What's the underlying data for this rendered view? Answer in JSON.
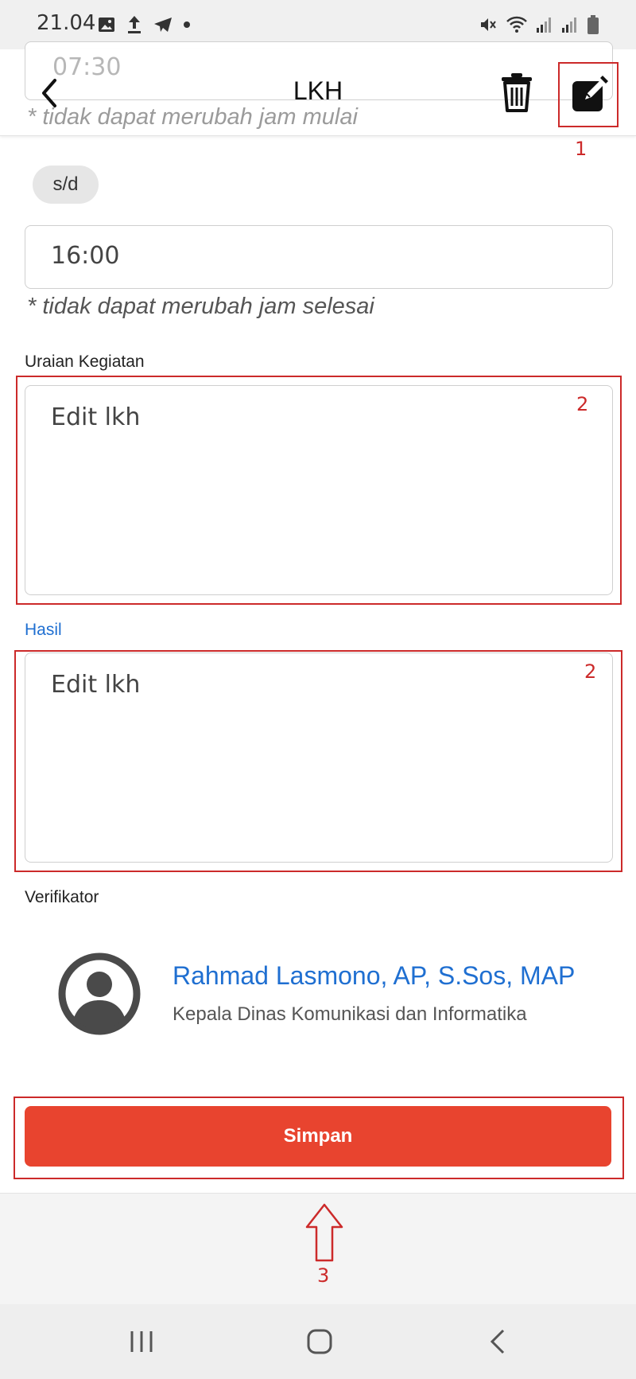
{
  "status_bar": {
    "time": "21.04",
    "icons_left": [
      "image-icon",
      "upload-icon",
      "telegram-icon",
      "dot-icon"
    ],
    "icons_right": [
      "mute-icon",
      "wifi-icon",
      "signal-icon",
      "signal-icon",
      "battery-icon"
    ]
  },
  "header": {
    "title": "LKH",
    "back_icon": "chevron-left-icon",
    "delete_icon": "trash-icon",
    "edit_icon": "edit-icon"
  },
  "form": {
    "start_time_value": "07:30",
    "start_hint": "* tidak dapat merubah jam mulai",
    "range_chip": "s/d",
    "end_time_value": "16:00",
    "end_hint": "* tidak dapat merubah jam selesai",
    "uraian_label": "Uraian Kegiatan",
    "uraian_value": "Edit lkh",
    "hasil_label": "Hasil",
    "hasil_value": "Edit lkh",
    "verifikator_label": "Verifikator"
  },
  "verifikator": {
    "name": "Rahmad Lasmono, AP, S.Sos, MAP",
    "role": "Kepala Dinas Komunikasi dan Informatika"
  },
  "actions": {
    "save_label": "Simpan"
  },
  "annotations": {
    "edit_marker": "1",
    "uraian_marker": "2",
    "hasil_marker": "2",
    "save_marker": "3"
  },
  "colors": {
    "accent_blue": "#1f6fd1",
    "save_red": "#e8442f",
    "annotation_red": "#cc2a2a"
  },
  "nav_bar": [
    "recent-apps-icon",
    "home-icon",
    "back-icon"
  ]
}
